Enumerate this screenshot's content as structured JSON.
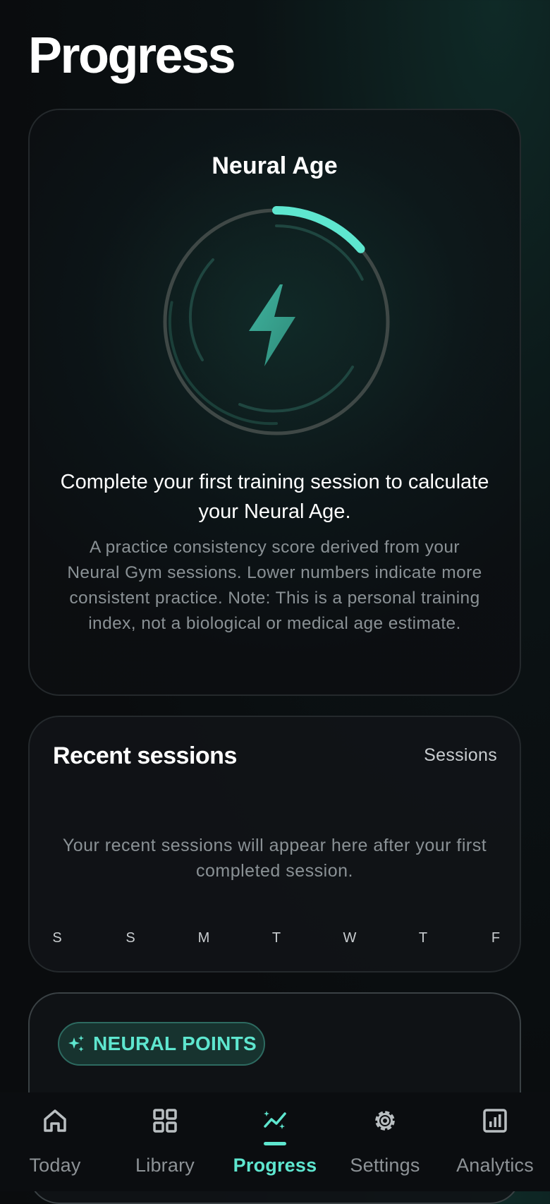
{
  "page": {
    "title": "Progress"
  },
  "neural_age": {
    "title": "Neural Age",
    "headline": "Complete your first training session to calculate your Neural Age.",
    "description": "A practice consistency score derived from your Neural Gym sessions. Lower numbers indicate more consistent practice. Note: This is a personal training index, not a biological or medical age estimate.",
    "icon": "lightning-bolt-icon",
    "accent_color": "#5ee6cf"
  },
  "recent_sessions": {
    "title": "Recent sessions",
    "link_label": "Sessions",
    "empty_message": "Your recent sessions will appear here after your first completed session.",
    "days": [
      "S",
      "S",
      "M",
      "T",
      "W",
      "T",
      "F"
    ]
  },
  "neural_points": {
    "badge_label": "NEURAL POINTS",
    "icon": "sparkles-icon"
  },
  "nav": {
    "items": [
      {
        "label": "Today",
        "icon": "home-icon",
        "active": false
      },
      {
        "label": "Library",
        "icon": "grid-icon",
        "active": false
      },
      {
        "label": "Progress",
        "icon": "trend-icon",
        "active": true
      },
      {
        "label": "Settings",
        "icon": "gear-icon",
        "active": false
      },
      {
        "label": "Analytics",
        "icon": "bar-chart-icon",
        "active": false
      }
    ]
  },
  "colors": {
    "accent": "#5ee6cf",
    "background": "#0a0c0e",
    "muted_text": "#8a9195"
  }
}
